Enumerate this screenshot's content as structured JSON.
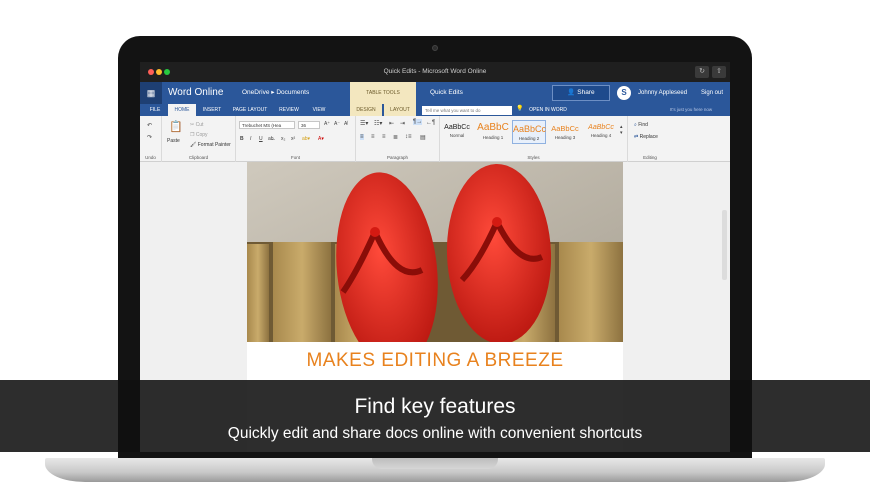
{
  "window": {
    "title": "Quick Edits - Microsoft Word Online"
  },
  "header": {
    "app_name": "Word Online",
    "breadcrumb": "OneDrive ▸ Documents",
    "contextual_tab": "TABLE TOOLS",
    "doc_title": "Quick Edits",
    "share_label": "Share",
    "user_name": "Johnny Appleseed",
    "sign_out": "Sign out"
  },
  "tabs": [
    "FILE",
    "HOME",
    "INSERT",
    "PAGE LAYOUT",
    "REVIEW",
    "VIEW",
    "DESIGN",
    "LAYOUT"
  ],
  "tell_me_placeholder": "Tell me what you want to do",
  "open_in_word": "OPEN IN WORD",
  "save_status": "It's just you here now",
  "ribbon": {
    "undo_group": "Undo",
    "clipboard": {
      "label": "Clipboard",
      "paste": "Paste",
      "cut": "Cut",
      "copy": "Copy",
      "format_painter": "Format Painter"
    },
    "font": {
      "label": "Font",
      "family": "Trebuchet MS (Hea",
      "size": "36"
    },
    "paragraph": {
      "label": "Paragraph"
    },
    "styles": {
      "label": "Styles",
      "items": [
        {
          "sample": "AaBbCc",
          "name": "Normal"
        },
        {
          "sample": "AaBbC",
          "name": "Heading 1"
        },
        {
          "sample": "AaBbCc",
          "name": "Heading 2"
        },
        {
          "sample": "AaBbCc",
          "name": "Heading 3"
        },
        {
          "sample": "AaBbCc",
          "name": "Heading 4"
        }
      ]
    },
    "editing": {
      "label": "Editing",
      "find": "Find",
      "replace": "Replace"
    }
  },
  "document": {
    "heading": "MAKES EDITING A BREEZE"
  },
  "banner": {
    "title": "Find key features",
    "subtitle": "Quickly edit and share docs online with convenient shortcuts"
  },
  "colors": {
    "word_blue": "#2b579a",
    "heading_orange": "#e8821e",
    "contextual": "#f3e7bf"
  }
}
